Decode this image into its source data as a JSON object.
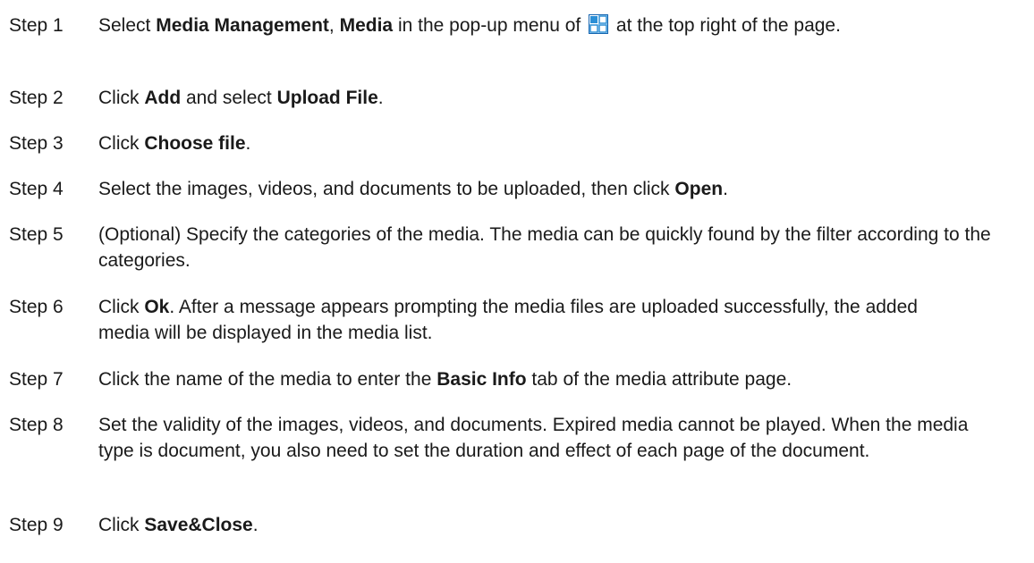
{
  "steps": [
    {
      "label": "Step 1",
      "parts": [
        {
          "t": "Select "
        },
        {
          "t": "Media Management",
          "b": true
        },
        {
          "t": ", "
        },
        {
          "t": "Media",
          "b": true
        },
        {
          "t": " in the pop-up menu of "
        },
        {
          "icon": "menu-grid-icon"
        },
        {
          "t": " at the top right of the page."
        }
      ]
    },
    {
      "label": "Step 2",
      "parts": [
        {
          "t": "Click "
        },
        {
          "t": "Add",
          "b": true
        },
        {
          "t": " and select "
        },
        {
          "t": "Upload File",
          "b": true
        },
        {
          "t": "."
        }
      ]
    },
    {
      "label": "Step 3",
      "parts": [
        {
          "t": "Click "
        },
        {
          "t": "Choose file",
          "b": true
        },
        {
          "t": "."
        }
      ]
    },
    {
      "label": "Step 4",
      "parts": [
        {
          "t": "Select the images, videos, and documents to be uploaded, then click "
        },
        {
          "t": "Open",
          "b": true
        },
        {
          "t": "."
        }
      ]
    },
    {
      "label": "Step 5",
      "parts": [
        {
          "t": "(Optional) Specify the categories of the media. The media can be quickly found by the filter according to the categories."
        }
      ]
    },
    {
      "label": "Step 6",
      "parts": [
        {
          "t": "Click "
        },
        {
          "t": "Ok",
          "b": true
        },
        {
          "t": ". After a message appears prompting the media files are uploaded successfully, the added media will be displayed in the media list."
        }
      ]
    },
    {
      "label": "Step 7",
      "parts": [
        {
          "t": "Click the name of the media to enter the "
        },
        {
          "t": "Basic Info",
          "b": true
        },
        {
          "t": " tab of the media attribute page."
        }
      ]
    },
    {
      "label": "Step 8",
      "parts": [
        {
          "t": "Set the validity of the images, videos, and documents. Expired media cannot be played. When the media type is document, you also need to set the duration and effect of each page of the document."
        }
      ]
    },
    {
      "label": "Step 9",
      "parts": [
        {
          "t": "Click "
        },
        {
          "t": "Save&Close",
          "b": true
        },
        {
          "t": "."
        }
      ]
    }
  ],
  "colors": {
    "text": "#1a1a1a",
    "icon_fill": "#2b8fd6",
    "icon_border": "#1565b0"
  }
}
